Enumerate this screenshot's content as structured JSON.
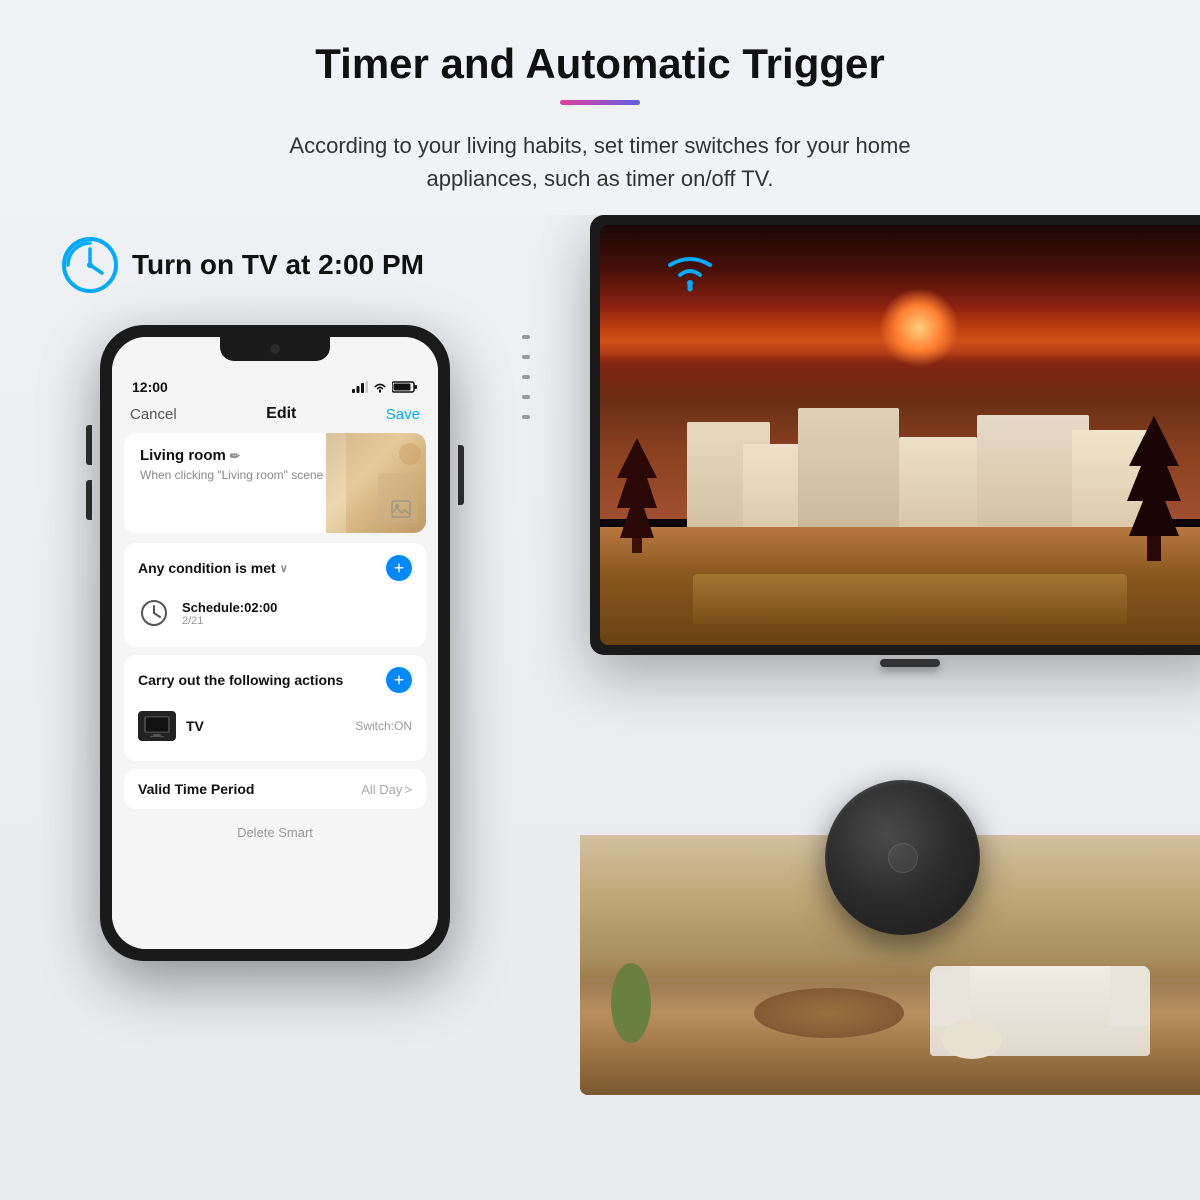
{
  "header": {
    "title": "Timer and Automatic Trigger",
    "description": "According to your living habits, set timer switches for your home appliances, such as timer on/off TV.",
    "underline_colors": [
      "#e040a0",
      "#6060e0"
    ]
  },
  "timer_label": {
    "text": "Turn on TV at 2:00 PM"
  },
  "phone": {
    "status_bar": {
      "time": "12:00",
      "signal": "▐▌▌",
      "wifi": "WiFi",
      "battery": "🔋"
    },
    "app_header": {
      "cancel": "Cancel",
      "title": "Edit",
      "save": "Save"
    },
    "scene_card": {
      "name": "Living room",
      "edit_icon": "✏",
      "subtitle": "When clicking \"Living room\" scene"
    },
    "condition_section": {
      "title": "Any condition is met",
      "chevron": "∨",
      "add_btn": "+",
      "schedule": {
        "time": "Schedule:02:00",
        "date": "2/21"
      }
    },
    "actions_section": {
      "title": "Carry out the following actions",
      "add_btn": "+",
      "tv_item": {
        "label": "TV",
        "status": "Switch:ON"
      }
    },
    "valid_section": {
      "label": "Valid Time Period",
      "value": "All Day",
      "chevron": ">"
    },
    "delete_btn": "Delete Smart"
  },
  "wifi_icon": "WiFi",
  "hub_device_alt": "Smart Hub Device"
}
